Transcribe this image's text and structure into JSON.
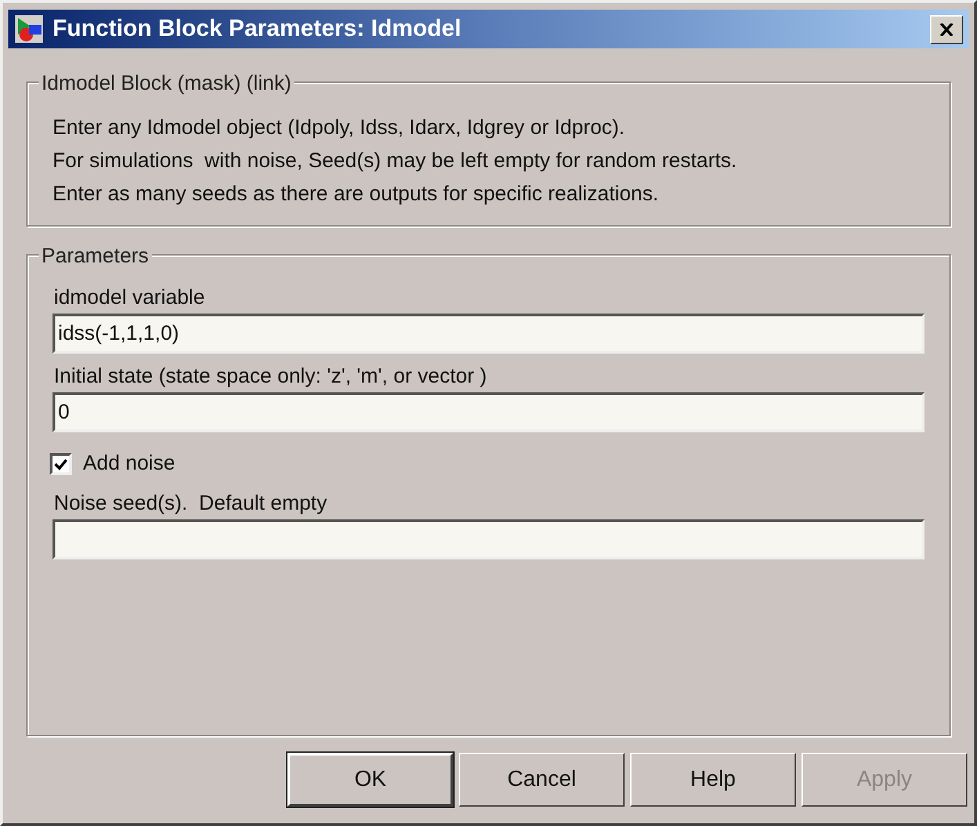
{
  "window": {
    "title": "Function Block Parameters: Idmodel"
  },
  "description": {
    "title": "Idmodel Block (mask) (link)",
    "lines": [
      "Enter any Idmodel object (Idpoly, Idss, Idarx, Idgrey or Idproc).",
      "For simulations  with noise, Seed(s) may be left empty for random restarts.",
      "Enter as many seeds as there are outputs for specific realizations."
    ]
  },
  "parameters": {
    "title": "Parameters",
    "items": [
      {
        "kind": "field",
        "label": "idmodel variable",
        "value": "idss(-1,1,1,0)"
      },
      {
        "kind": "field",
        "label": "Initial state (state space only: 'z', 'm', or vector )",
        "value": "0"
      },
      {
        "kind": "checkbox",
        "label": "Add noise",
        "checked": true
      },
      {
        "kind": "field",
        "label": "Noise seed(s).  Default empty"
      }
    ]
  },
  "buttons": [
    {
      "label": "OK",
      "default": true,
      "disabled": false
    },
    {
      "label": "Cancel",
      "default": false,
      "disabled": false
    },
    {
      "label": "Help",
      "default": false,
      "disabled": false
    },
    {
      "label": "Apply",
      "default": false,
      "disabled": true
    }
  ]
}
